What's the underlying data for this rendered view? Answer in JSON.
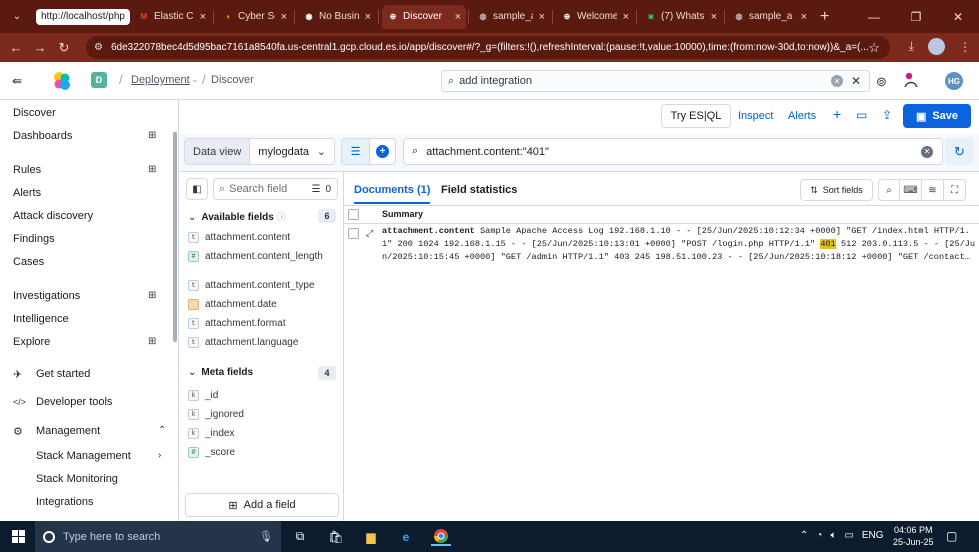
{
  "browser": {
    "tabs": [
      {
        "label": "http://localhost/phpm",
        "fav": "",
        "color": "#ffffff"
      },
      {
        "label": "Elastic Cl",
        "fav": "M",
        "color": "#ea4335"
      },
      {
        "label": "Cyber Se",
        "fav": "◖",
        "color": "#f4b400"
      },
      {
        "label": "No Busin",
        "fav": "◉",
        "color": "#ffffff"
      },
      {
        "label": "Discover",
        "fav": "⊕",
        "color": "#ffffff"
      },
      {
        "label": "sample_a",
        "fav": "◍",
        "color": "#c0c0c0"
      },
      {
        "label": "Welcome",
        "fav": "⊕",
        "color": "#ffffff"
      },
      {
        "label": "(7) Whats",
        "fav": "◙",
        "color": "#25d366"
      },
      {
        "label": "sample_a",
        "fav": "◍",
        "color": "#c0c0c0"
      }
    ],
    "close_glyph": "×",
    "new_tab": "+",
    "url": "6de322078bec4d5d95bac7161a8540fa.us-central1.gcp.cloud.es.io/app/discover#/?_g=(filters:!(),refreshInterval:(pause:!t,value:10000),time:(from:now-30d,to:now))&_a=(...",
    "window_controls": [
      "—",
      "❐",
      "✕"
    ]
  },
  "kibana_header": {
    "space_initial": "D",
    "breadcrumb_deployment": "Deployment",
    "breadcrumb_discover": "Discover",
    "search_placeholder": "add integration",
    "avatar_initials": "HG"
  },
  "left_nav": {
    "items": [
      {
        "label": "Discover"
      },
      {
        "label": "Dashboards"
      },
      {
        "label": "Rules"
      },
      {
        "label": "Alerts"
      },
      {
        "label": "Attack discovery"
      },
      {
        "label": "Findings"
      },
      {
        "label": "Cases"
      },
      {
        "label": "Investigations"
      },
      {
        "label": "Intelligence"
      },
      {
        "label": "Explore"
      }
    ],
    "sections": [
      {
        "label": "Get started"
      },
      {
        "label": "Developer tools"
      },
      {
        "label": "Management"
      }
    ],
    "sub_items": [
      {
        "label": "Stack Management"
      },
      {
        "label": "Stack Monitoring"
      },
      {
        "label": "Integrations"
      }
    ]
  },
  "toolbar": {
    "try_esql": "Try ES|QL",
    "inspect": "Inspect",
    "alerts": "Alerts",
    "save": "Save"
  },
  "query": {
    "data_view_label": "Data view",
    "data_view_value": "mylogdata",
    "query_text": "attachment.content:\"401\""
  },
  "field_sidebar": {
    "search_placeholder": "Search field",
    "filter_count": "0",
    "available_label": "Available fields",
    "available_count": "6",
    "available_fields": [
      {
        "type": "t",
        "name": "attachment.content"
      },
      {
        "type": "#",
        "name": "attachment.content_length"
      },
      {
        "type": "t",
        "name": "attachment.content_type"
      },
      {
        "type": "date",
        "name": "attachment.date"
      },
      {
        "type": "t",
        "name": "attachment.format"
      },
      {
        "type": "t",
        "name": "attachment.language"
      }
    ],
    "meta_label": "Meta fields",
    "meta_count": "4",
    "meta_fields": [
      {
        "type": "k",
        "name": "_id"
      },
      {
        "type": "k",
        "name": "_ignored"
      },
      {
        "type": "k",
        "name": "_index"
      },
      {
        "type": "#",
        "name": "_score"
      }
    ],
    "add_field": "Add a field"
  },
  "documents": {
    "tab_documents": "Documents (1)",
    "tab_field_stats": "Field statistics",
    "sort_fields": "Sort fields",
    "summary_header": "Summary",
    "row_key": "attachment.content",
    "row_before": "Sample Apache Access Log 192.168.1.10 - - [25/Jun/2025:10:12:34 +0000] \"GET /index.html HTTP/1.1\" 200 1024 192.168.1.15 - - [25/Jun/2025:10:13:01 +0000] \"POST /login.php HTTP/1.1\" ",
    "row_highlight": "401",
    "row_after": " 512 203.0.113.5 - - [25/Jun/2025:10:15:45 +0000] \"GET /admin HTTP/1.1\" 403 245 198.51.100.23 - - [25/Jun/2025:10:18:12 +0000] \"GET /contact…"
  },
  "taskbar": {
    "search_placeholder": "Type here to search",
    "language": "ENG",
    "time": "04:06 PM",
    "date": "25-Jun-25"
  }
}
